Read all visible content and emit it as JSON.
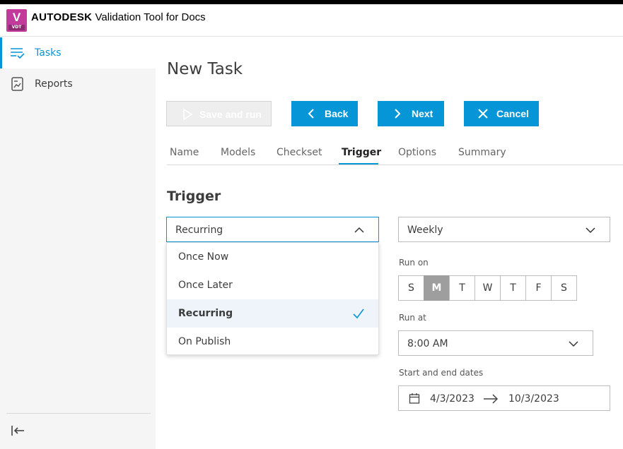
{
  "app": {
    "logo_letter": "V",
    "logo_sub": "VDT",
    "brand": "AUTODESK",
    "title": "Validation Tool for Docs"
  },
  "sidebar": {
    "items": [
      {
        "label": "Tasks",
        "icon": "tasks-list-icon",
        "active": true
      },
      {
        "label": "Reports",
        "icon": "report-icon",
        "active": false
      }
    ],
    "collapse_icon": "collapse-sidebar-icon"
  },
  "page": {
    "title": "New Task"
  },
  "toolbar": {
    "save_run_label": "Save and run",
    "back_label": "Back",
    "next_label": "Next",
    "cancel_label": "Cancel"
  },
  "tabs": [
    "Name",
    "Models",
    "Checkset",
    "Trigger",
    "Options",
    "Summary"
  ],
  "active_tab": "Trigger",
  "trigger": {
    "section_title": "Trigger",
    "selected": "Recurring",
    "options": [
      "Once Now",
      "Once Later",
      "Recurring",
      "On Publish"
    ],
    "frequency": "Weekly",
    "run_on_label": "Run on",
    "days": [
      "S",
      "M",
      "T",
      "W",
      "T",
      "F",
      "S"
    ],
    "selected_day": "M",
    "run_at_label": "Run at",
    "run_at": "8:00 AM",
    "dates_label": "Start and end dates",
    "start_date": "4/3/2023",
    "end_date": "10/3/2023"
  },
  "colors": {
    "accent": "#0696d7",
    "logo": "#c23b9b",
    "selected_row": "#eef4fa",
    "day_selected": "#9e9e9e",
    "sidebar_bg": "#f5f5f5"
  }
}
